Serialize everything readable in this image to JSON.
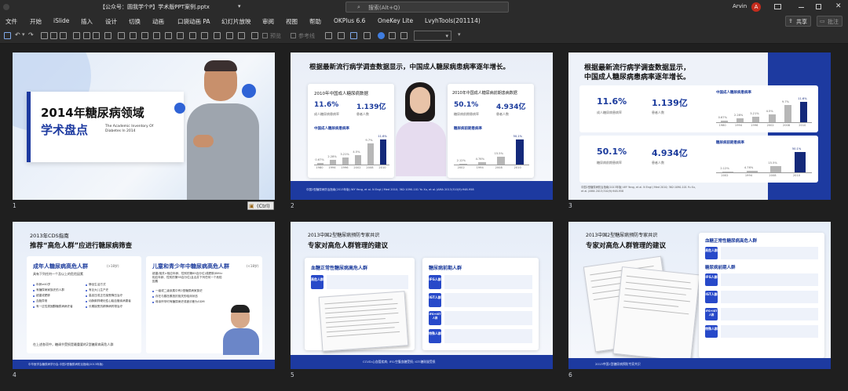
{
  "titlebar": {
    "doc_title": "【公众号：圆我学个P】学术版PPT案例.pptx",
    "search_placeholder": "搜索(Alt+Q)",
    "user_name": "Arvin",
    "avatar_letter": "A"
  },
  "menu": [
    "文件",
    "开始",
    "iSlide",
    "插入",
    "设计",
    "切换",
    "动画",
    "口袋动画 PA",
    "幻灯片放映",
    "审阅",
    "视图",
    "帮助",
    "OKPlus 6.6",
    "OneKey Lite",
    "LvyhTools(201114)"
  ],
  "share_label": "共享",
  "comment_label": "批注",
  "toolbar": {
    "preview_label": "预览",
    "ruler_label": "参考线"
  },
  "ctrl_badge": "(Ctrl)",
  "slides": [
    {
      "number": "1",
      "title_line1": "2014年糖尿病领域",
      "title_line2": "学术盘点",
      "subtitle_en": "The Academic Inventory Of Diabetes In 2014"
    },
    {
      "number": "2",
      "heading": "根据最新流行病学调查数据显示，中国成人糖尿病患病率逐年增长。",
      "left_panel_title": "2010年中国成人糖尿病数据",
      "left_stat1_value": "11.6%",
      "left_stat1_label": "成人糖尿病患病率",
      "left_stat2_value": "1.139亿",
      "left_stat2_label": "患者人数",
      "left_chart_title": "中国成人糖尿病患病率",
      "left_chart_unit": "(%)",
      "right_panel_title": "2010年中国成人糖尿病前期患病数据",
      "right_stat1_value": "50.1%",
      "right_stat1_label": "糖尿病前期患病率",
      "right_stat2_value": "4.934亿",
      "right_stat2_label": "患者人数",
      "right_chart_title": "糖尿病前期患病率",
      "right_chart_unit": "(%)",
      "ref": "中国2型糖尿病防治指南(2013年版) WY Yang, et al. N Engl J Med 2010; 362:1090-101 Yu Xu, et al. JAMA 2013;310(9):948-958"
    },
    {
      "number": "3",
      "heading_line1": "根据最新流行病学调查数据显示，",
      "heading_line2": "中国成人糖尿病患病率逐年增长。",
      "stat1_value": "11.6%",
      "stat1_label": "成人糖尿病患病率",
      "stat2_value": "1.139亿",
      "stat2_label": "患者人数",
      "stat3_value": "50.1%",
      "stat3_label": "糖尿病前期患病率",
      "stat4_value": "4.934亿",
      "stat4_label": "患者人数",
      "chart1_title": "中国成人糖尿病患病率",
      "chart2_title": "糖尿病前期患病率",
      "ref": "中国2型糖尿病防治指南(2013年版) WY Yang, et al. N Engl J Med 2010; 362:1090-101 Yu Xu, et al. JAMA 2013;310(9):948-958"
    },
    {
      "number": "4",
      "heading_line1": "2013年CDS指南",
      "heading_line2": "推荐“高危人群”应进行糖尿病筛查",
      "left_title": "成年人糖尿病高危人群",
      "left_title_note": "(>18岁)",
      "left_sub": "具有下列任何一个及以上的危险因素",
      "left_items": [
        "年龄≥40岁",
        "静坐生活方式",
        "有糖尿病家族史的人群",
        "有巨大儿生产史",
        "超重或肥胖",
        "高血压或正在接受降压治疗",
        "血脂异常",
        "动脉粥样硬化性心脑血管疾病患者",
        "有一过性类固醇糖尿病病史者",
        "长期接受抗精神病药物治疗"
      ],
      "right_title": "儿童和青少年中糖尿病高危人群",
      "right_title_note": "(<18岁)",
      "right_sub": "超重(相关>相应年龄、性别的第85百分位)或肥胖(BMI>相应年龄、性别的第95百分位)且合并下列任何一个危险因素",
      "right_items": [
        "一级或二级亲属中有2型糖尿病家族史",
        "存在与胰岛素抵抗相关的临床状态",
        "母亲怀孕时有糖尿病史或被诊断为GDM"
      ],
      "ref": "中华医学会糖尿病学分会.中国2型糖尿病防治指南(2013年版)",
      "footer_note": "在上述各项中，糖调节受损是最重要的2型糖尿病高危人群"
    },
    {
      "number": "5",
      "heading_line1": "2013中国2型糖尿病预防专家共识",
      "heading_line2": "专家对高危人群管理的建议",
      "panel_title": "血糖正常性糖尿病高危人群",
      "row_tag": "高危人群",
      "right_title": "糖尿病前期人群",
      "tags": [
        "IFG人群",
        "IGT人群",
        "IFG+IGT人群",
        "特殊人群"
      ],
      "footer": "CCVD:心血管疾病; IFG:空腹血糖受损; IGT:糖耐量受损"
    },
    {
      "number": "6",
      "heading_line1": "2013中国2型糖尿病预防专家共识",
      "heading_line2": "专家对高危人群管理的建议",
      "panel_title": "血糖正常性糖尿病高危人群",
      "right_title": "糖尿病前期人群",
      "tags": [
        "高危人群",
        "IFG人群",
        "IGT人群",
        "IFG+IGT人群",
        "特殊人群"
      ],
      "footer": "2013中国2型糖尿病预防专家共识"
    }
  ],
  "chart_data": [
    {
      "type": "bar",
      "title": "中国成人糖尿病患病率",
      "categories": [
        "1980",
        "1994",
        "1996",
        "2002",
        "2008",
        "2010"
      ],
      "values": [
        0.67,
        2.28,
        3.21,
        4.5,
        9.7,
        11.6
      ],
      "ylabel": "(%)"
    },
    {
      "type": "bar",
      "title": "糖尿病前期患病率",
      "categories": [
        "2002",
        "1994",
        "2008",
        "2010"
      ],
      "values": [
        2.12,
        4.76,
        15.5,
        50.1
      ],
      "ylabel": "(%)"
    }
  ],
  "colors": {
    "accent": "#1d3aa0",
    "avatar": "#c42b1c",
    "bar_grey": "#b7b7b7",
    "bar_dark": "#14297a"
  }
}
